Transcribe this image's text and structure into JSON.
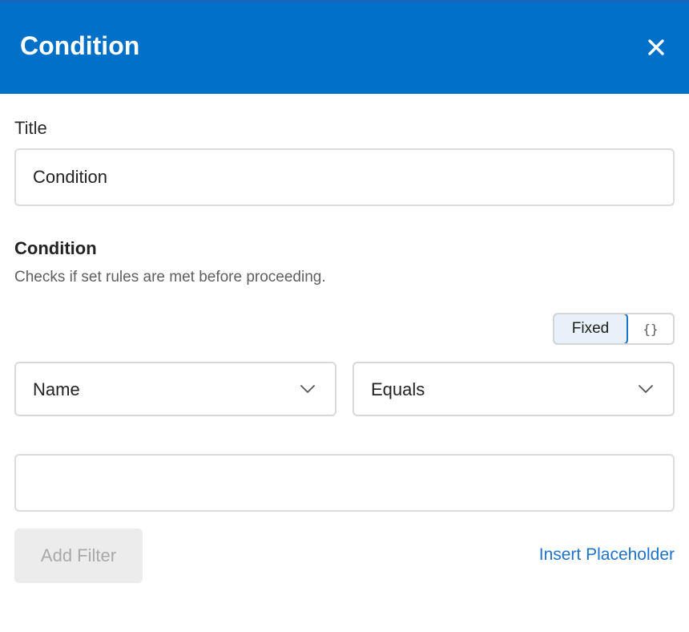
{
  "dialog": {
    "title": "Condition",
    "close_icon": "close-icon"
  },
  "title_field": {
    "label": "Title",
    "value": "Condition"
  },
  "condition_section": {
    "heading": "Condition",
    "description": "Checks if set rules are met before proceeding."
  },
  "mode_toggle": {
    "fixed_label": "Fixed",
    "dynamic_label": "{}",
    "selected": "Fixed"
  },
  "filter": {
    "field_select": {
      "value": "Name",
      "icon": "chevron-down-icon"
    },
    "operator_select": {
      "value": "Equals",
      "icon": "chevron-down-icon"
    },
    "value_input": {
      "value": "",
      "placeholder": ""
    }
  },
  "actions": {
    "add_filter_label": "Add Filter",
    "add_filter_disabled": true,
    "insert_placeholder_label": "Insert Placeholder"
  },
  "colors": {
    "header_bg": "#0070c9",
    "accent": "#1f73c6",
    "toggle_selected_bg": "#e8f1fa",
    "disabled_button_bg": "#ececec"
  }
}
